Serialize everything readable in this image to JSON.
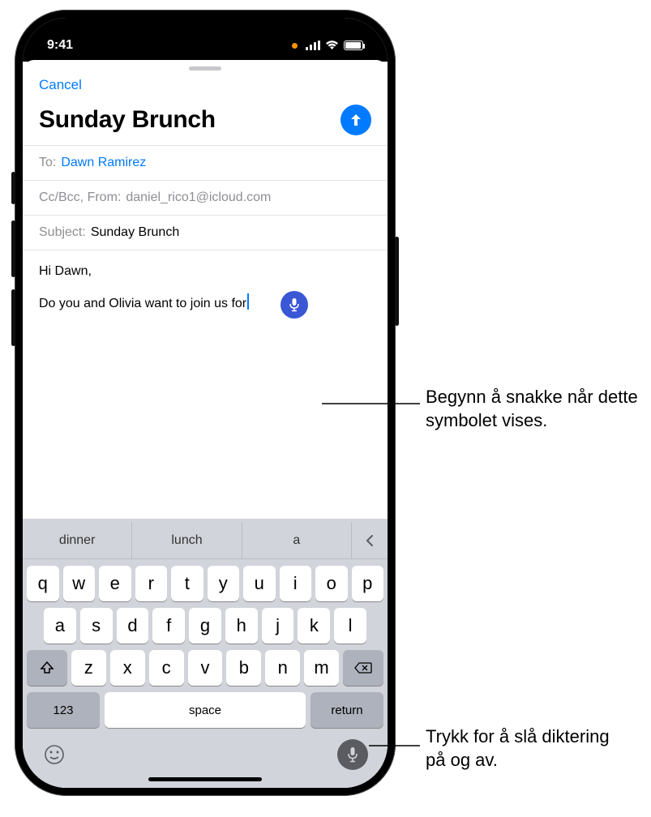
{
  "status": {
    "time": "9:41"
  },
  "nav": {
    "cancel": "Cancel"
  },
  "compose": {
    "title": "Sunday Brunch",
    "to_label": "To:",
    "to_recipient": "Dawn Ramirez",
    "cc_bcc_from_label": "Cc/Bcc, From:",
    "from_value": "daniel_rico1@icloud.com",
    "subject_label": "Subject:",
    "subject_value": "Sunday Brunch",
    "body_line1": "Hi Dawn,",
    "body_line2": "Do you and Olivia want to join us for"
  },
  "keyboard": {
    "suggestions": [
      "dinner",
      "lunch",
      "a"
    ],
    "row1": [
      "q",
      "w",
      "e",
      "r",
      "t",
      "y",
      "u",
      "i",
      "o",
      "p"
    ],
    "row2": [
      "a",
      "s",
      "d",
      "f",
      "g",
      "h",
      "j",
      "k",
      "l"
    ],
    "row3": [
      "z",
      "x",
      "c",
      "v",
      "b",
      "n",
      "m"
    ],
    "numbers_key": "123",
    "space_key": "space",
    "return_key": "return"
  },
  "callouts": {
    "dictation_start": "Begynn å snakke når dette symbolet vises.",
    "dictation_toggle": "Trykk for å slå diktering på og av."
  },
  "icons": {
    "send": "send-arrow-up",
    "dictation_bubble": "microphone",
    "emoji": "smiley",
    "mic_toggle": "microphone",
    "shift": "shift",
    "delete": "delete",
    "collapse": "chevron-left"
  }
}
